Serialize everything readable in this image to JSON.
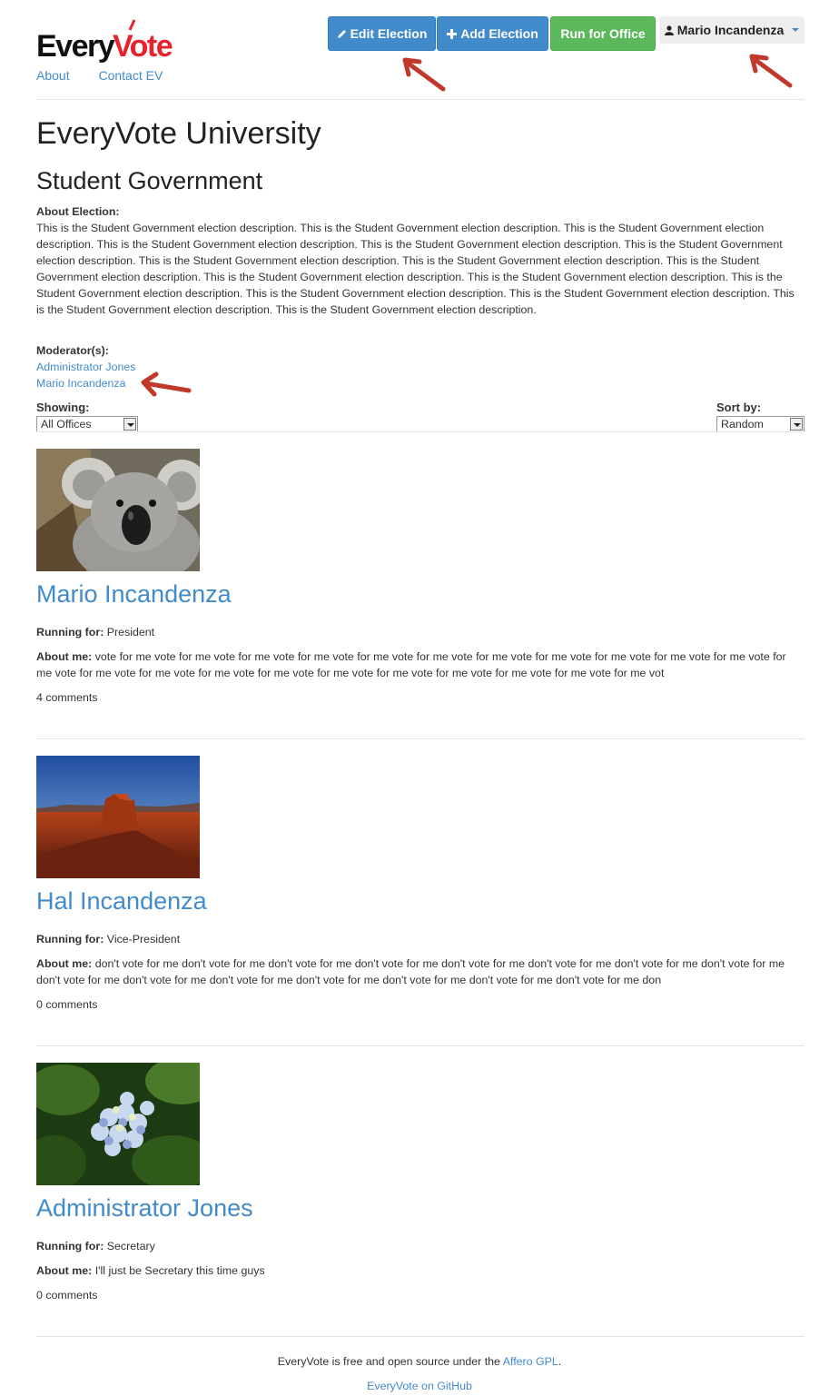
{
  "brand": {
    "logo_text_part1": "Every",
    "logo_text_part2": "Vote"
  },
  "nav": {
    "about": "About",
    "contact": "Contact EV"
  },
  "actions": {
    "edit_election": "Edit Election",
    "add_election": "Add Election",
    "run_for_office": "Run for Office",
    "user_name": "Mario Incandenza"
  },
  "page": {
    "university": "EveryVote University",
    "election": "Student Government",
    "about_label": "About Election:",
    "about_text": "This is the Student Government election description. This is the Student Government election description. This is the Student Government election description. This is the Student Government election description. This is the Student Government election description. This is the Student Government election description. This is the Student Government election description. This is the Student Government election description. This is the Student Government election description. This is the Student Government election description. This is the Student Government election description. This is the Student Government election description. This is the Student Government election description. This is the Student Government election description. This is the Student Government election description. This is the Student Government election description.",
    "moderators_label": "Moderator(s):",
    "moderators": [
      "Administrator Jones",
      "Mario Incandenza"
    ]
  },
  "filters": {
    "showing_label": "Showing:",
    "showing_value": "All Offices",
    "sort_label": "Sort by:",
    "sort_value": "Random"
  },
  "candidates": [
    {
      "name": "Mario Incandenza",
      "running_label": "Running for:",
      "office": "President",
      "about_label": "About me:",
      "about": "vote for me vote for me vote for me vote for me vote for me vote for me vote for me vote for me vote for me vote for me vote for me vote for me vote for me vote for me vote for me vote for me vote for me vote for me vote for me vote for me vote for me vote for me vot",
      "comments": "4 comments",
      "image": "koala"
    },
    {
      "name": "Hal Incandenza",
      "running_label": "Running for:",
      "office": "Vice-President",
      "about_label": "About me:",
      "about": "don't vote for me don't vote for me don't vote for me don't vote for me don't vote for me don't vote for me don't vote for me don't vote for me don't vote for me don't vote for me don't vote for me don't vote for me don't vote for me don't vote for me don't vote for me don",
      "comments": "0 comments",
      "image": "desert"
    },
    {
      "name": "Administrator Jones",
      "running_label": "Running for:",
      "office": "Secretary",
      "about_label": "About me:",
      "about": "I'll just be Secretary this time guys",
      "comments": "0 comments",
      "image": "hydrangea"
    }
  ],
  "footer": {
    "text": "EveryVote is free and open source under the",
    "license_link": "Affero GPL",
    "period": ".",
    "github_link": "EveryVote on GitHub"
  },
  "colors": {
    "link": "#428bca",
    "primary": "#428bca",
    "success": "#5cb85c",
    "brand_red": "#e8222d",
    "annotation_arrow": "#c0392b"
  },
  "icons": {
    "edit": "pencil-icon",
    "add": "plus-icon",
    "user": "user-icon",
    "dropdown": "caret-down-icon"
  }
}
